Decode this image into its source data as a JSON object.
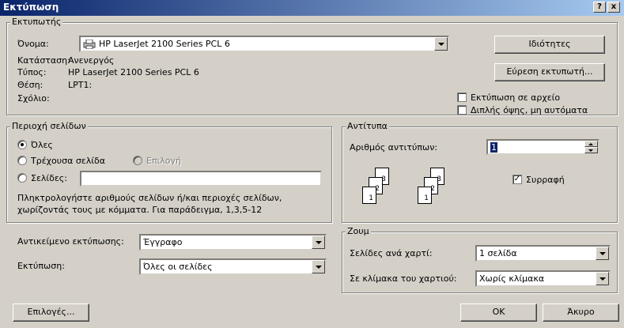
{
  "window": {
    "title": "Εκτύπωση",
    "help_btn": "?",
    "close_btn": "x"
  },
  "printer": {
    "group_label": "Εκτυπωτής",
    "name_label": "Όνομα:",
    "name_value": "HP LaserJet 2100 Series PCL 6",
    "status_label": "Κατάσταση:",
    "status_value": "Ανενεργός",
    "type_label": "Τύπος:",
    "type_value": "HP LaserJet 2100 Series PCL 6",
    "where_label": "Θέση:",
    "where_value": "LPT1:",
    "comment_label": "Σχόλιο:",
    "properties_button": "Ιδιότητες",
    "find_printer_button": "Εύρεση εκτυπωτή...",
    "print_to_file": {
      "label": "Εκτύπωση σε αρχείο",
      "checked": false
    },
    "manual_duplex": {
      "label": "Διπλής όψης, μη αυτόματα",
      "checked": false
    }
  },
  "page_range": {
    "group_label": "Περιοχή σελίδων",
    "all": {
      "label": "Όλες",
      "selected": true
    },
    "current": {
      "label": "Τρέχουσα σελίδα",
      "selected": false
    },
    "selection": {
      "label": "Επιλογή",
      "selected": false,
      "enabled": false
    },
    "pages": {
      "label": "Σελίδες:",
      "selected": false,
      "value": ""
    },
    "hint_line1": "Πληκτρολογήστε αριθμούς σελίδων ή/και περιοχές σελίδων,",
    "hint_line2": "χωρίζοντάς τους με κόμματα. Για παράδειγμα, 1,3,5-12"
  },
  "copies": {
    "group_label": "Αντίτυπα",
    "count_label": "Αριθμός αντιτύπων:",
    "count_value": "1",
    "collate": {
      "label": "Συρραφή",
      "checked": true
    },
    "page_numbers": [
      "3",
      "2",
      "1"
    ]
  },
  "print_what": {
    "label": "Αντικείμενο εκτύπωσης:",
    "value": "Έγγραφο"
  },
  "print": {
    "label": "Εκτύπωση:",
    "value": "Όλες οι σελίδες"
  },
  "zoom": {
    "group_label": "Ζουμ",
    "pages_per_sheet_label": "Σελίδες ανά χαρτί:",
    "pages_per_sheet_value": "1 σελίδα",
    "scale_label": "Σε κλίμακα του χαρτιού:",
    "scale_value": "Χωρίς κλίμακα"
  },
  "buttons": {
    "options": "Επιλογές...",
    "ok": "OK",
    "cancel": "Άκυρο"
  },
  "icons": {
    "printer": "printer-icon"
  }
}
